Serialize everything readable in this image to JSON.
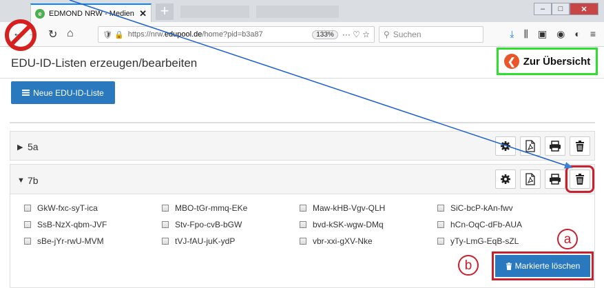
{
  "browser": {
    "tab_title": "EDMOND NRW - Medien für Sc",
    "tab_favicon_letter": "e",
    "url_prefix": "https://nrw.",
    "url_domain": "edupool.de",
    "url_suffix": "/home?pid=b3a87",
    "zoom": "133%",
    "url_actions": "··· ♡ ☆",
    "search_placeholder": "Suchen"
  },
  "page": {
    "title": "EDU-ID-Listen erzeugen/bearbeiten",
    "back_label": "Zur Übersicht",
    "new_list_label": "Neue EDU-ID-Liste"
  },
  "lists": [
    {
      "name": "5a",
      "expanded": false
    },
    {
      "name": "7b",
      "expanded": true
    }
  ],
  "ids": [
    "GkW-fxc-syT-ica",
    "MBO-tGr-mmq-EKe",
    "Maw-kHB-Vgv-QLH",
    "SiC-bcP-kAn-fwv",
    "SsB-NzX-qbm-JVF",
    "Stv-Fpo-cvB-bGW",
    "bvd-kSK-wgw-DMq",
    "hCn-OqC-dFb-AUA",
    "sBe-jYr-rwU-MVM",
    "tVJ-fAU-juK-ydP",
    "vbr-xxi-gXV-Nke",
    "yTy-LmG-EqB-sZL"
  ],
  "delete_marked_label": "Markierte löschen",
  "callouts": {
    "a": "a",
    "b": "b"
  },
  "colors": {
    "primary": "#2a79bf",
    "highlight_red": "#c8202c",
    "highlight_green": "#2ee02e",
    "back_circle": "#e8562a",
    "arrow": "#1c5fcf"
  },
  "icons": [
    "gear-icon",
    "pdf-icon",
    "print-icon",
    "trash-icon"
  ]
}
